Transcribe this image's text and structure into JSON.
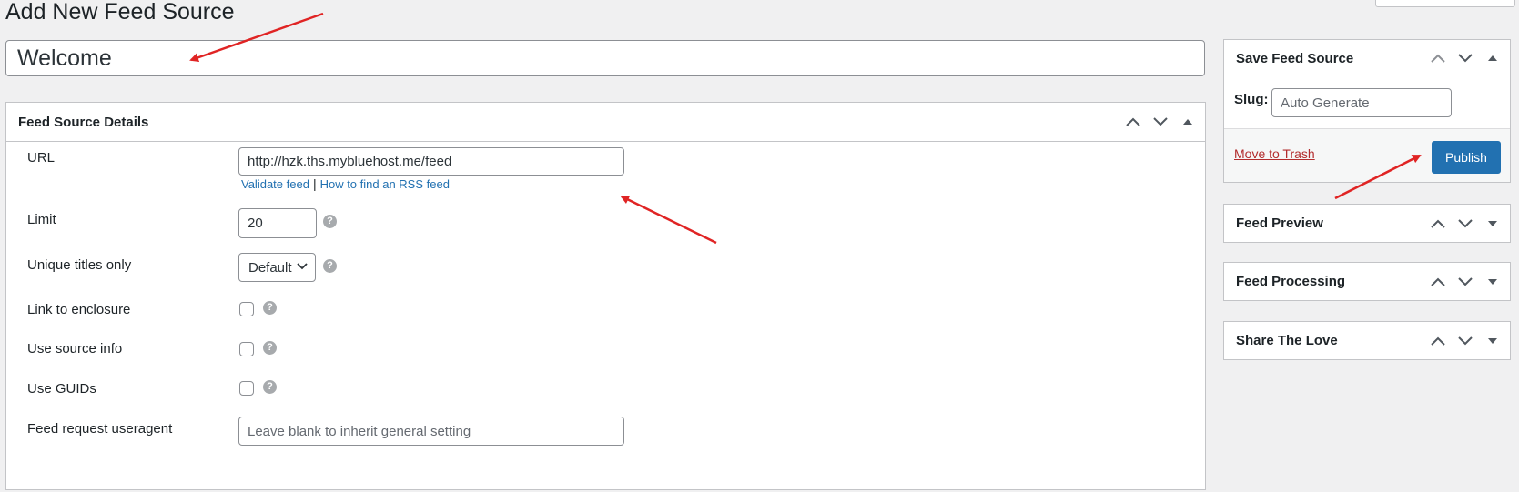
{
  "page": {
    "title": "Add New Feed Source",
    "post_title_value": "Welcome"
  },
  "details": {
    "heading": "Feed Source Details",
    "url_label": "URL",
    "url_value": "http://hzk.ths.mybluehost.me/feed",
    "validate_link": "Validate feed",
    "separator": "|",
    "rss_help_link": "How to find an RSS feed",
    "limit_label": "Limit",
    "limit_value": "20",
    "unique_label": "Unique titles only",
    "unique_selected": "Default",
    "enclosure_label": "Link to enclosure",
    "source_info_label": "Use source info",
    "guids_label": "Use GUIDs",
    "useragent_label": "Feed request useragent",
    "useragent_placeholder": "Leave blank to inherit general setting",
    "help_glyph": "?"
  },
  "sidebar": {
    "save": {
      "heading": "Save Feed Source",
      "slug_label": "Slug:",
      "slug_placeholder": "Auto Generate",
      "trash_link": "Move to Trash",
      "publish_label": "Publish"
    },
    "preview_heading": "Feed Preview",
    "processing_heading": "Feed Processing",
    "share_heading": "Share The Love"
  },
  "colors": {
    "accent": "#2271b1",
    "danger": "#b32d2e",
    "annotation_arrow": "#e02424",
    "background": "#f0f0f1"
  }
}
